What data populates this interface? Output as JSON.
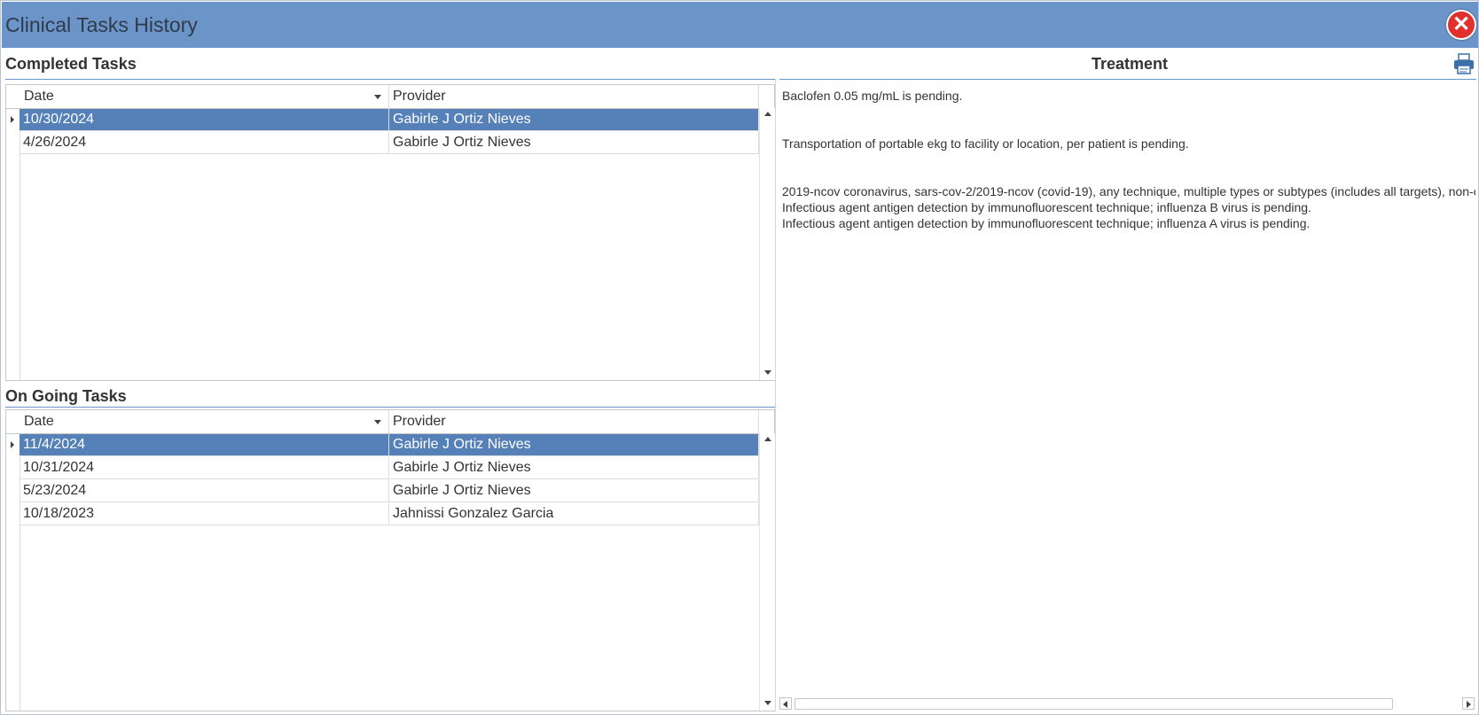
{
  "window": {
    "title": "Clinical Tasks History",
    "close_icon": "close-icon",
    "accent_color": "#6b95c9",
    "selected_row_color": "#5580b8"
  },
  "completed": {
    "title": "Completed Tasks",
    "columns": [
      "Date",
      "Provider"
    ],
    "rows": [
      {
        "date": "10/30/2024",
        "provider": "Gabirle J Ortiz Nieves",
        "selected": true
      },
      {
        "date": "4/26/2024",
        "provider": "Gabirle J Ortiz Nieves",
        "selected": false
      }
    ]
  },
  "ongoing": {
    "title": "On Going Tasks",
    "columns": [
      "Date",
      "Provider"
    ],
    "rows": [
      {
        "date": "11/4/2024",
        "provider": "Gabirle J Ortiz Nieves",
        "selected": true
      },
      {
        "date": "10/31/2024",
        "provider": "Gabirle J Ortiz Nieves",
        "selected": false
      },
      {
        "date": "5/23/2024",
        "provider": "Gabirle J Ortiz Nieves",
        "selected": false
      },
      {
        "date": "10/18/2023",
        "provider": "Jahnissi Gonzalez Garcia",
        "selected": false
      }
    ]
  },
  "treatment": {
    "title": "Treatment",
    "print_icon": "printer-icon",
    "lines": [
      "Baclofen 0.05 mg/mL is pending.",
      "",
      "",
      "Transportation of portable ekg to facility or location, per patient is pending.",
      "",
      "",
      "2019-ncov coronavirus, sars-cov-2/2019-ncov (covid-19), any technique, multiple types or subtypes (includes all targets), non-c",
      "Infectious agent antigen detection by immunofluorescent technique; influenza B virus is pending.",
      "Infectious agent antigen detection by immunofluorescent technique; influenza A virus is pending."
    ]
  }
}
